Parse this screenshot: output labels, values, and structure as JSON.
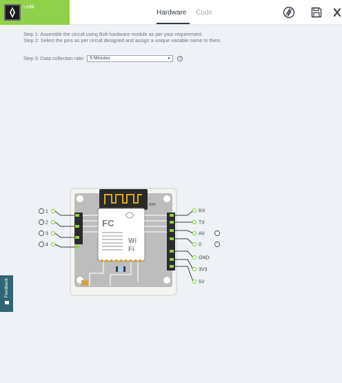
{
  "header": {
    "project_name": "Ledd",
    "tabs": [
      {
        "label": "Hardware",
        "active": true
      },
      {
        "label": "Code",
        "active": false
      }
    ],
    "tools": [
      "deploy-icon",
      "save-icon",
      "close-icon"
    ]
  },
  "instructions": {
    "step1": "Step 1: Assemble the circuit using Bolt hardware module as per your requirement.",
    "step2": "Step 2: Select the pins as per circuit designed and assign a unique variable name to them.",
    "step3_label": "Step 3: Data collection rate:",
    "rate_value": "5 Minutes"
  },
  "board": {
    "wifi_label": "WiFi",
    "left_pins": [
      "1",
      "2",
      "3",
      "4"
    ],
    "right_pins": [
      "RX",
      "TX",
      "A0",
      "0",
      "GND",
      "3V3",
      "5V"
    ]
  },
  "feedback": {
    "label": "Feedback"
  },
  "colors": {
    "brand": "#8fd14a",
    "pin_ring": "#8fd14a",
    "feedback": "#2f6575"
  }
}
